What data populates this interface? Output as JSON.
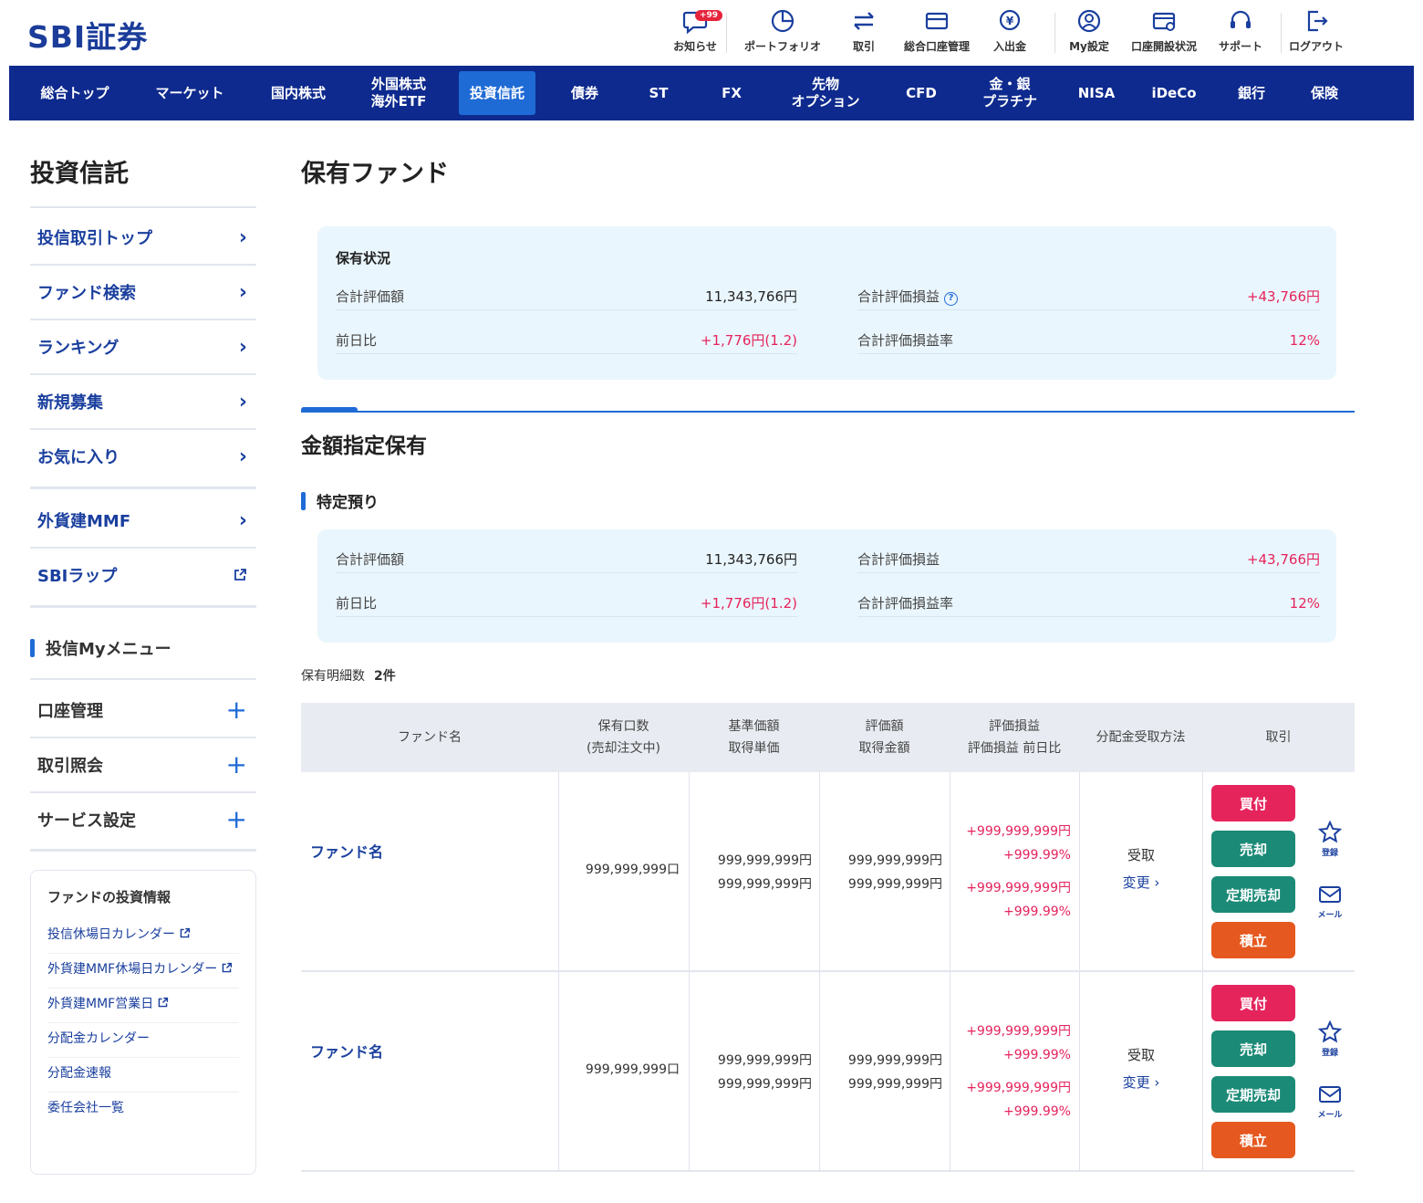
{
  "header": {
    "logo": "SBI証券",
    "badge": "+99",
    "utils": [
      {
        "label": "お知らせ",
        "icon": "notification-icon"
      },
      {
        "label": "ポートフォリオ",
        "icon": "portfolio-icon"
      },
      {
        "label": "取引",
        "icon": "trade-icon"
      },
      {
        "label": "総合口座管理",
        "icon": "account-icon"
      },
      {
        "label": "入出金",
        "icon": "deposit-icon"
      },
      {
        "label": "My設定",
        "icon": "my-settings-icon"
      },
      {
        "label": "口座開設状況",
        "icon": "account-opening-icon"
      },
      {
        "label": "サポート",
        "icon": "support-icon"
      },
      {
        "label": "ログアウト",
        "icon": "logout-icon"
      }
    ]
  },
  "nav": [
    {
      "label": "総合トップ"
    },
    {
      "label": "マーケット"
    },
    {
      "label": "国内株式"
    },
    {
      "label": "外国株式\n海外ETF"
    },
    {
      "label": "投資信託",
      "active": true
    },
    {
      "label": "債券"
    },
    {
      "label": "ST"
    },
    {
      "label": "FX"
    },
    {
      "label": "先物\nオプション"
    },
    {
      "label": "CFD"
    },
    {
      "label": "金・銀\nプラチナ"
    },
    {
      "label": "NISA"
    },
    {
      "label": "iDeCo"
    },
    {
      "label": "銀行"
    },
    {
      "label": "保険"
    }
  ],
  "sidebar": {
    "title": "投資信託",
    "items": [
      {
        "label": "投信取引トップ"
      },
      {
        "label": "ファンド検索"
      },
      {
        "label": "ランキング"
      },
      {
        "label": "新規募集"
      },
      {
        "label": "お気に入り"
      },
      {
        "label": "外貨建MMF"
      },
      {
        "label": "SBIラップ"
      }
    ],
    "my_menu": "投信Myメニュー",
    "expandables": [
      {
        "label": "口座管理"
      },
      {
        "label": "取引照会"
      },
      {
        "label": "サービス設定"
      }
    ],
    "info": {
      "title": "ファンドの投資情報",
      "links": [
        {
          "label": "投信休場日カレンダー"
        },
        {
          "label": "外貨建MMF休場日カレンダー"
        },
        {
          "label": "外貨建MMF営業日"
        },
        {
          "label": "分配金カレンダー"
        },
        {
          "label": "分配金速報"
        },
        {
          "label": "委任会社一覧"
        }
      ]
    }
  },
  "main": {
    "title": "保有ファンド",
    "summary": {
      "heading": "保有状況",
      "total_value_label": "合計評価額",
      "total_value": "11,343,766円",
      "total_gain_label": "合計評価損益",
      "total_gain": "+43,766円",
      "daily_label": "前日比",
      "daily": "+1,776円(1.2)",
      "gain_rate_label": "合計評価損益率",
      "gain_rate": "12%"
    },
    "section_title": "金額指定保有",
    "sub_title": "特定預り",
    "sub_summary": {
      "total_value_label": "合計評価額",
      "total_value": "11,343,766円",
      "total_gain_label": "合計評価損益",
      "total_gain": "+43,766円",
      "daily_label": "前日比",
      "daily": "+1,776円(1.2)",
      "gain_rate_label": "合計評価損益率",
      "gain_rate": "12%"
    },
    "count_label": "保有明細数",
    "count_value": "2件",
    "table": {
      "headers": [
        "ファンド名",
        "保有口数\n(売却注文中)",
        "基準価額\n取得単価",
        "評価額\n取得金額",
        "評価損益\n評価損益 前日比",
        "分配金受取方法",
        "取引"
      ],
      "rows": [
        {
          "name": "ファンド名",
          "units": "999,999,999口",
          "nav": "999,999,999円",
          "unit_cost": "999,999,999円",
          "value": "999,999,999円",
          "cost": "999,999,999円",
          "gain": "+999,999,999円",
          "gain_pct": "+999.99%",
          "daily_gain": "+999,999,999円",
          "daily_pct": "+999.99%",
          "receive": "受取",
          "change": "変更"
        },
        {
          "name": "ファンド名",
          "units": "999,999,999口",
          "nav": "999,999,999円",
          "unit_cost": "999,999,999円",
          "value": "999,999,999円",
          "cost": "999,999,999円",
          "gain": "+999,999,999円",
          "gain_pct": "+999.99%",
          "daily_gain": "+999,999,999円",
          "daily_pct": "+999.99%",
          "receive": "受取",
          "change": "変更"
        }
      ],
      "buttons": {
        "buy": "買付",
        "sell": "売却",
        "regular_sell": "定期売却",
        "accumulate": "積立"
      },
      "icons": {
        "register": "登録",
        "mail": "メール"
      }
    }
  },
  "colors": {
    "brand": "#0e2a8e",
    "accent": "#1f6bd6",
    "positive": "#e5245c",
    "buy": "#e5245c",
    "sell": "#1b8a77",
    "accumulate": "#e5581f"
  }
}
